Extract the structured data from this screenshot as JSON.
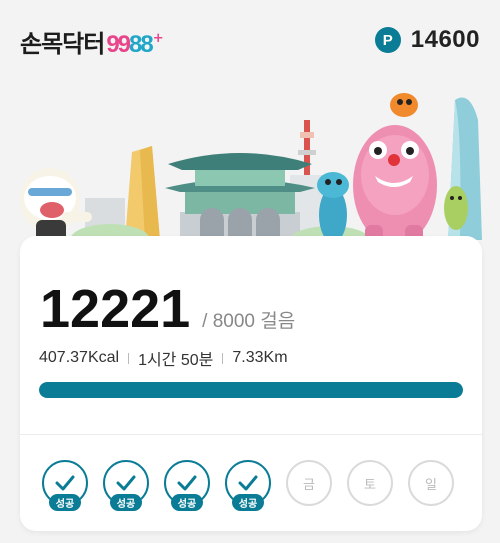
{
  "header": {
    "logo_korean": "손목닥터",
    "logo_number_a": "99",
    "logo_number_b": "88",
    "logo_plus": "+",
    "points_icon": "P",
    "points_value": "14600"
  },
  "banner": {
    "icon": "seoul-landmarks-illustration"
  },
  "summary": {
    "steps": "12221",
    "goal_text": "/ 8000 걸음",
    "calories": "407.37Kcal",
    "duration": "1시간 50분",
    "distance": "7.33Km",
    "progress_fraction": 1.0
  },
  "week": {
    "days": [
      {
        "label": "",
        "status": "done",
        "badge": "성공"
      },
      {
        "label": "",
        "status": "done",
        "badge": "성공"
      },
      {
        "label": "",
        "status": "done",
        "badge": "성공"
      },
      {
        "label": "",
        "status": "done",
        "badge": "성공"
      },
      {
        "label": "금",
        "status": "todo",
        "badge": ""
      },
      {
        "label": "토",
        "status": "todo",
        "badge": ""
      },
      {
        "label": "일",
        "status": "todo",
        "badge": ""
      }
    ]
  },
  "colors": {
    "accent": "#0b7c95",
    "brand_pink": "#e8458b",
    "brand_blue": "#1fa6c8"
  }
}
